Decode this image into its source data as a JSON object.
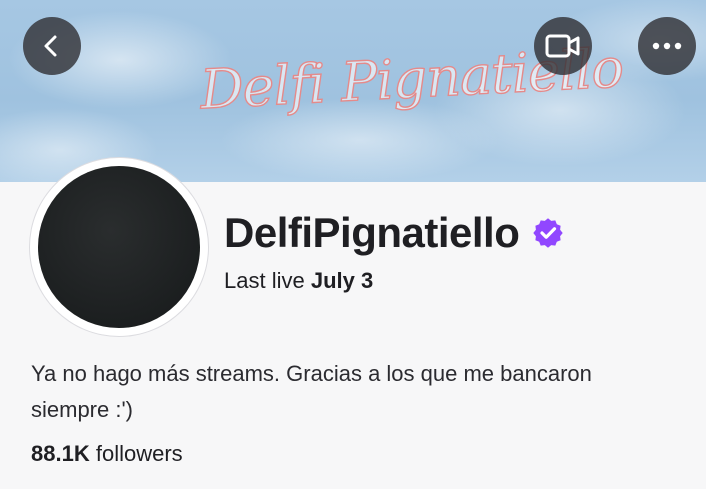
{
  "banner": {
    "signature_text": "Delfi Pignatiello",
    "sky_color": "#a6c7e3",
    "signature_color": "#e58a8a"
  },
  "nav": {
    "back_icon": "chevron-left-icon",
    "video_icon": "video-camera-icon",
    "more_icon": "more-horizontal-icon"
  },
  "profile": {
    "channel_name": "DelfiPignatiello",
    "verified_icon": "verified-badge-icon",
    "verified_color": "#9147ff",
    "last_live_label": "Last live",
    "last_live_date": "July 3",
    "bio": "Ya no hago más streams. Gracias a los que me bancaron siempre :')",
    "followers_count": "88.1K",
    "followers_label": "followers"
  }
}
